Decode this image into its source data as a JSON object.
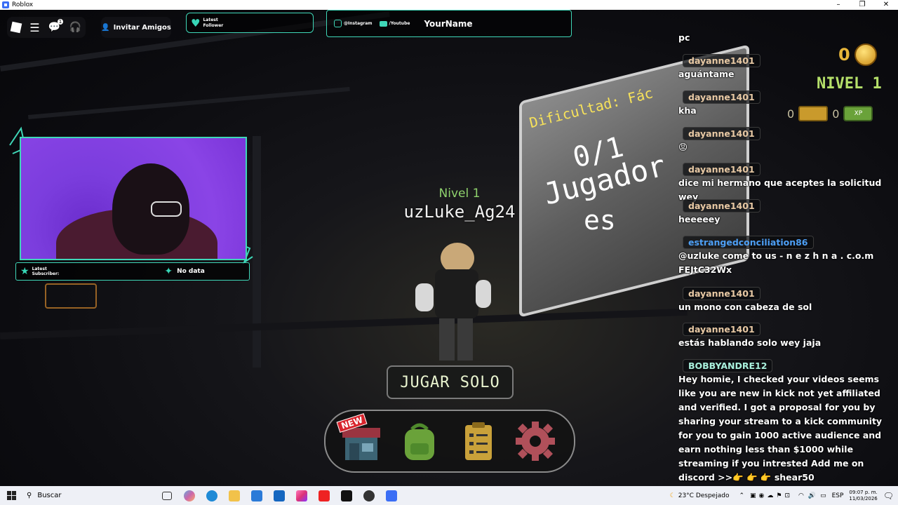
{
  "window": {
    "title": "Roblox",
    "controls": [
      "–",
      "❐",
      "✕"
    ]
  },
  "topbar": {
    "invite_label": "Invitar Amigos",
    "notification_count": "1"
  },
  "overlay": {
    "follower_label": "Latest",
    "follower_label2": "Follower",
    "instagram": "@Instagram",
    "youtube": "/Youtube",
    "your_name": "YourName",
    "subscriber_label": "Latest",
    "subscriber_label2": "Subscriber:",
    "no_data": "No data",
    "accent_color": "#3fd7b8"
  },
  "player": {
    "level": "Nivel 1",
    "name": "uzLuke_Ag24"
  },
  "billboard": {
    "difficulty": "Dificultad: Fác",
    "count": "0/1",
    "players": "Jugador",
    "players2": "es"
  },
  "hud": {
    "coins": "0",
    "level": "NIVEL 1",
    "tickets": "0",
    "xp": "0",
    "xp_badge": "XP"
  },
  "chat": {
    "messages": [
      {
        "user": "",
        "text": "pc"
      },
      {
        "user": "dayanne1401",
        "text": "aguántame"
      },
      {
        "user": "dayanne1401",
        "text": "kha"
      },
      {
        "user": "dayanne1401",
        "text": "😡"
      },
      {
        "user": "dayanne1401",
        "text": "dice mi hermano que aceptes la solicitud wey"
      },
      {
        "user": "dayanne1401",
        "text": "heeeeey"
      },
      {
        "user": "estrangedconciliation86",
        "text": "@uzluke come to us - n e z h n a . c.o.m FEJtC32Wx"
      },
      {
        "user": "dayanne1401",
        "text": "un mono con cabeza de sol"
      },
      {
        "user": "dayanne1401",
        "text": "estás hablando solo wey jaja"
      },
      {
        "user": "BOBBYANDRE12",
        "text": "Hey homie, I checked your videos seems like you are new in kick not yet affiliated and verified. I got a proposal for you by sharing your stream to a kick community for you to gain 1000 active audience and earn nothing less than $1000 while streaming if you intrested Add me on discord >>👉 👉 👉 shear50"
      }
    ]
  },
  "buttons": {
    "play_solo": "JUGAR SOLO",
    "new_badge": "NEW"
  },
  "taskbar": {
    "search_placeholder": "Buscar",
    "weather": "23°C Despejado",
    "language": "ESP",
    "time": "09:07 p. m.",
    "date": "11/03/2026"
  }
}
